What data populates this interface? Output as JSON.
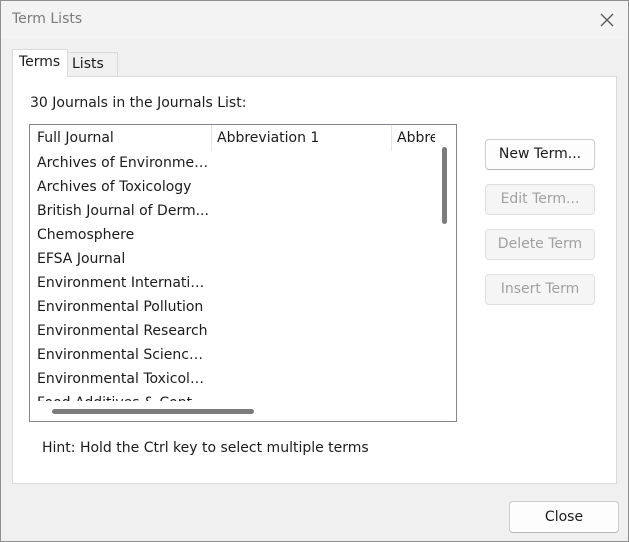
{
  "window": {
    "title": "Term Lists",
    "close_icon": "close-icon"
  },
  "tabs": [
    {
      "label": "Terms",
      "selected": true
    },
    {
      "label": "Lists",
      "selected": false
    }
  ],
  "list_caption": "30 Journals in the Journals List:",
  "columns": [
    "Full Journal",
    "Abbreviation 1",
    "Abbre"
  ],
  "rows": [
    "Archives of Environmen...",
    "Archives of Toxicology",
    "British Journal of Derm...",
    "Chemosphere",
    "EFSA Journal",
    "Environment Internatio...",
    "Environmental Pollution",
    "Environmental Research",
    "Environmental Science ...",
    "Environmental Toxicolo...",
    "Food Additives & Cont..."
  ],
  "buttons": {
    "new_term": {
      "label": "New Term...",
      "enabled": true
    },
    "edit_term": {
      "label": "Edit Term...",
      "enabled": false
    },
    "delete_term": {
      "label": "Delete Term",
      "enabled": false
    },
    "insert_term": {
      "label": "Insert Term",
      "enabled": false
    }
  },
  "hint": "Hint: Hold the Ctrl key to select multiple terms",
  "close_button": "Close"
}
